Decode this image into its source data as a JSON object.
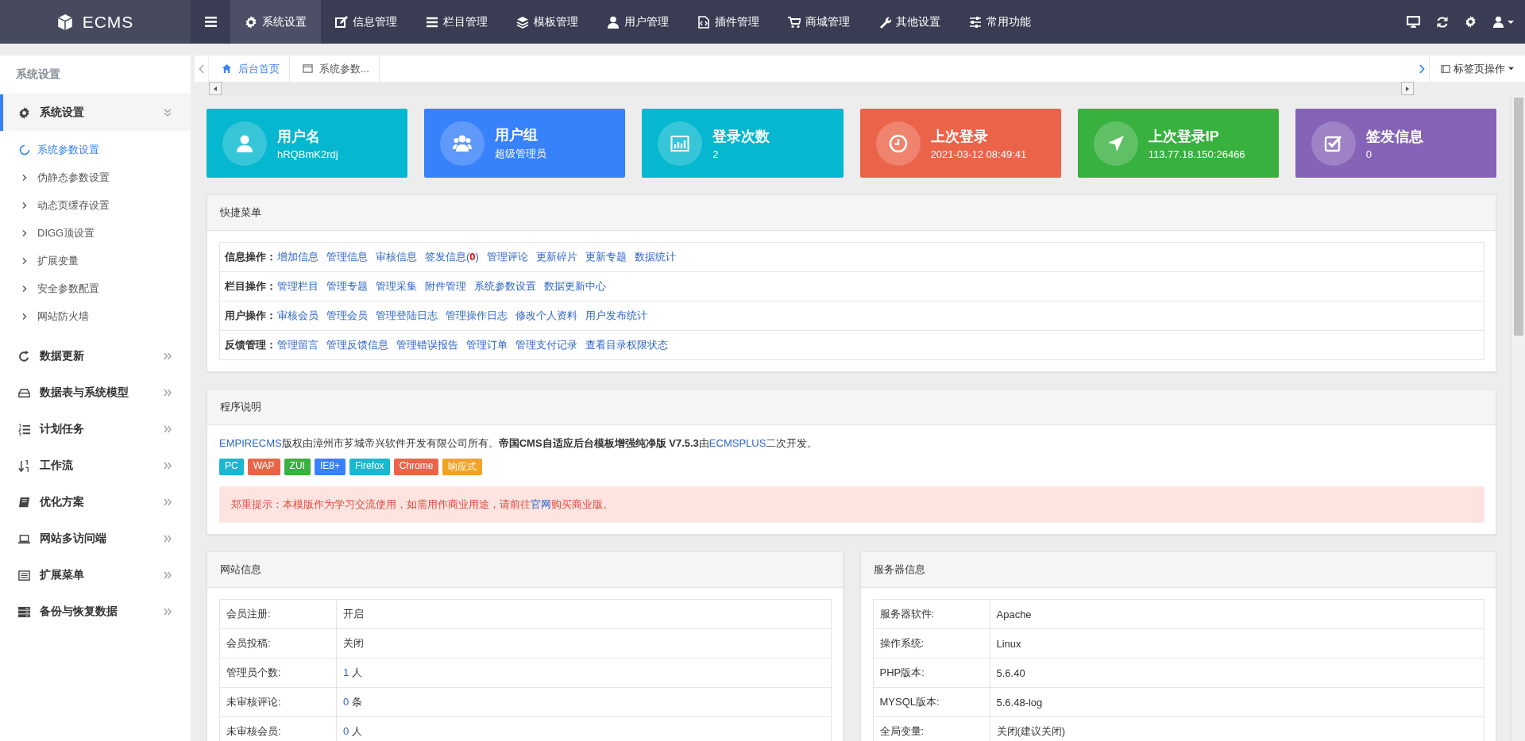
{
  "logo": {
    "text": "ECMS"
  },
  "top_nav": [
    {
      "label": "系统设置",
      "selected": true
    },
    {
      "label": "信息管理",
      "selected": false
    },
    {
      "label": "栏目管理",
      "selected": false
    },
    {
      "label": "模板管理",
      "selected": false
    },
    {
      "label": "用户管理",
      "selected": false
    },
    {
      "label": "插件管理",
      "selected": false
    },
    {
      "label": "商城管理",
      "selected": false
    },
    {
      "label": "其他设置",
      "selected": false
    },
    {
      "label": "常用功能",
      "selected": false
    }
  ],
  "sidebar": {
    "title": "系统设置",
    "groups": [
      {
        "label": "系统设置",
        "selected": true,
        "expanded": true,
        "children": [
          {
            "label": "系统参数设置",
            "selected": true
          },
          {
            "label": "伪静态参数设置",
            "selected": false
          },
          {
            "label": "动态页缓存设置",
            "selected": false
          },
          {
            "label": "DIGG顶设置",
            "selected": false
          },
          {
            "label": "扩展变量",
            "selected": false
          },
          {
            "label": "安全参数配置",
            "selected": false
          },
          {
            "label": "网站防火墙",
            "selected": false
          }
        ]
      },
      {
        "label": "数据更新",
        "selected": false,
        "expanded": false
      },
      {
        "label": "数据表与系统模型",
        "selected": false,
        "expanded": false
      },
      {
        "label": "计划任务",
        "selected": false,
        "expanded": false
      },
      {
        "label": "工作流",
        "selected": false,
        "expanded": false
      },
      {
        "label": "优化方案",
        "selected": false,
        "expanded": false
      },
      {
        "label": "网站多访问端",
        "selected": false,
        "expanded": false
      },
      {
        "label": "扩展菜单",
        "selected": false,
        "expanded": false
      },
      {
        "label": "备份与恢复数据",
        "selected": false,
        "expanded": false
      }
    ]
  },
  "tabs": [
    {
      "label": "后台首页",
      "selected": true
    },
    {
      "label": "系统参数...",
      "selected": false
    }
  ],
  "tab_actions": {
    "label": "标签页操作"
  },
  "stats": [
    {
      "title": "用户名",
      "value": "hRQBmK2rdj",
      "color": "#05b8cf"
    },
    {
      "title": "用户组",
      "value": "超级管理员",
      "color": "#3781fb"
    },
    {
      "title": "登录次数",
      "value": "2",
      "color": "#05b8cf"
    },
    {
      "title": "上次登录",
      "value": "2021-03-12 08:49:41",
      "color": "#eb6449"
    },
    {
      "title": "上次登录IP",
      "value": "113.77.18.150:26466",
      "color": "#38b13f"
    },
    {
      "title": "签发信息",
      "value": "0",
      "color": "#8564b7"
    }
  ],
  "quick_menu": {
    "title": "快捷菜单",
    "rows": [
      {
        "label": "信息操作：",
        "links": [
          "增加信息",
          "管理信息",
          "审核信息",
          "签发信息(**0**)",
          "管理评论",
          "更新碎片",
          "更新专题",
          "数据统计"
        ]
      },
      {
        "label": "栏目操作：",
        "links": [
          "管理栏目",
          "管理专题",
          "管理采集",
          "附件管理",
          "系统参数设置",
          "数据更新中心"
        ]
      },
      {
        "label": "用户操作：",
        "links": [
          "审核会员",
          "管理会员",
          "管理登陆日志",
          "管理操作日志",
          "修改个人资料",
          "用户发布统计"
        ]
      },
      {
        "label": "反馈管理：",
        "links": [
          "管理留言",
          "管理反馈信息",
          "管理错误报告",
          "管理订单",
          "管理支付记录",
          "查看目录权限状态"
        ]
      }
    ]
  },
  "program": {
    "title": "程序说明",
    "description": [
      {
        "kind": "link",
        "text": "EMPIRECMS"
      },
      {
        "kind": "text",
        "text": "版权由漳州市芗城帝兴软件开发有限公司所有。"
      },
      {
        "kind": "bold",
        "text": "帝国CMS自适应后台模板增强纯净版 V7.5.3"
      },
      {
        "kind": "text",
        "text": "由"
      },
      {
        "kind": "link",
        "text": "ECMSPLUS"
      },
      {
        "kind": "text",
        "text": "二次开发。"
      }
    ],
    "badges": [
      {
        "text": "PC",
        "color": "#17b8d0"
      },
      {
        "text": "WAP",
        "color": "#ec6448"
      },
      {
        "text": "ZUI",
        "color": "#37b13f"
      },
      {
        "text": "IE8+",
        "color": "#3781fb"
      },
      {
        "text": "Firefox",
        "color": "#17b8d0"
      },
      {
        "text": "Chrome",
        "color": "#ec6448"
      },
      {
        "text": "响应式",
        "color": "#f1a325"
      }
    ],
    "notice": [
      {
        "kind": "text",
        "text": "郑重提示：本模版作为学习交流使用，如需用作商业用途，请前往"
      },
      {
        "kind": "link",
        "text": "官网"
      },
      {
        "kind": "text",
        "text": "购买商业版。"
      }
    ]
  },
  "site_info": {
    "title": "网站信息",
    "rows": [
      {
        "label": "会员注册:",
        "value": "开启"
      },
      {
        "label": "会员投稿:",
        "value": "关闭"
      },
      {
        "label": "管理员个数:",
        "value": "1",
        "unit": "人"
      },
      {
        "label": "未审核评论:",
        "value": "0",
        "unit": "条"
      },
      {
        "label": "未审核会员:",
        "value": "0",
        "unit": "人"
      }
    ]
  },
  "server_info": {
    "title": "服务器信息",
    "rows": [
      {
        "label": "服务器软件:",
        "value": "Apache"
      },
      {
        "label": "操作系统:",
        "value": "Linux"
      },
      {
        "label": "PHP版本:",
        "value": "5.6.40"
      },
      {
        "label": "MYSQL版本:",
        "value": "5.6.48-log"
      },
      {
        "label": "全局变量:",
        "value": "关闭(建议关闭)"
      }
    ]
  }
}
